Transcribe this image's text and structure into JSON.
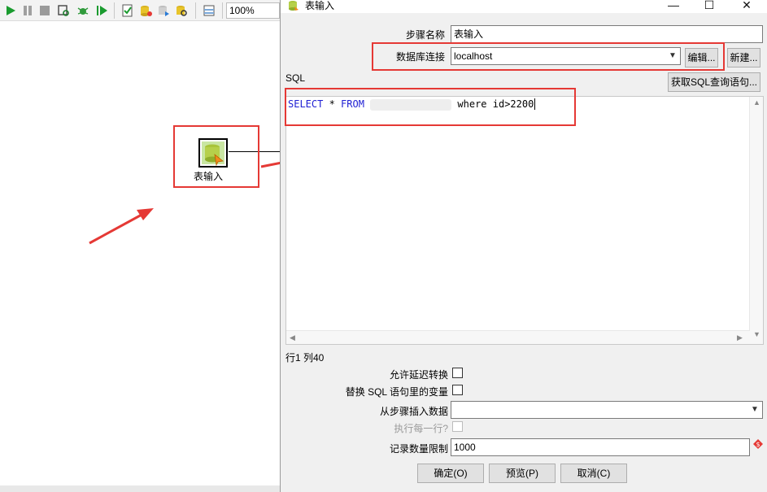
{
  "toolbar": {
    "zoom": "100%"
  },
  "canvas": {
    "step_label": "表输入"
  },
  "dialog": {
    "title": "表输入",
    "controls": {
      "minimize": "—",
      "maximize": "☐",
      "close": "✕"
    },
    "step_name_label": "步骤名称",
    "step_name_value": "表输入",
    "db_connection_label": "数据库连接",
    "db_connection_value": "localhost",
    "edit_button": "编辑...",
    "new_button": "新建...",
    "sql_label": "SQL",
    "get_sql_button": "获取SQL查询语句...",
    "sql": {
      "kw_select": "SELECT",
      "star": " * ",
      "kw_from": "FROM",
      "rest": " where id>2200"
    },
    "cursor_position": "行1 列40",
    "allow_lazy_label": "允许延迟转换",
    "replace_vars_label": "替换 SQL 语句里的变量",
    "insert_from_step_label": "从步骤插入数据",
    "execute_each_row_label": "执行每一行?",
    "limit_label": "记录数量限制",
    "limit_value": "1000",
    "ok_button": "确定(O)",
    "preview_button": "预览(P)",
    "cancel_button": "取消(C)"
  },
  "colors": {
    "annotation_red": "#e53935",
    "sql_keyword": "#1f1fd3"
  }
}
